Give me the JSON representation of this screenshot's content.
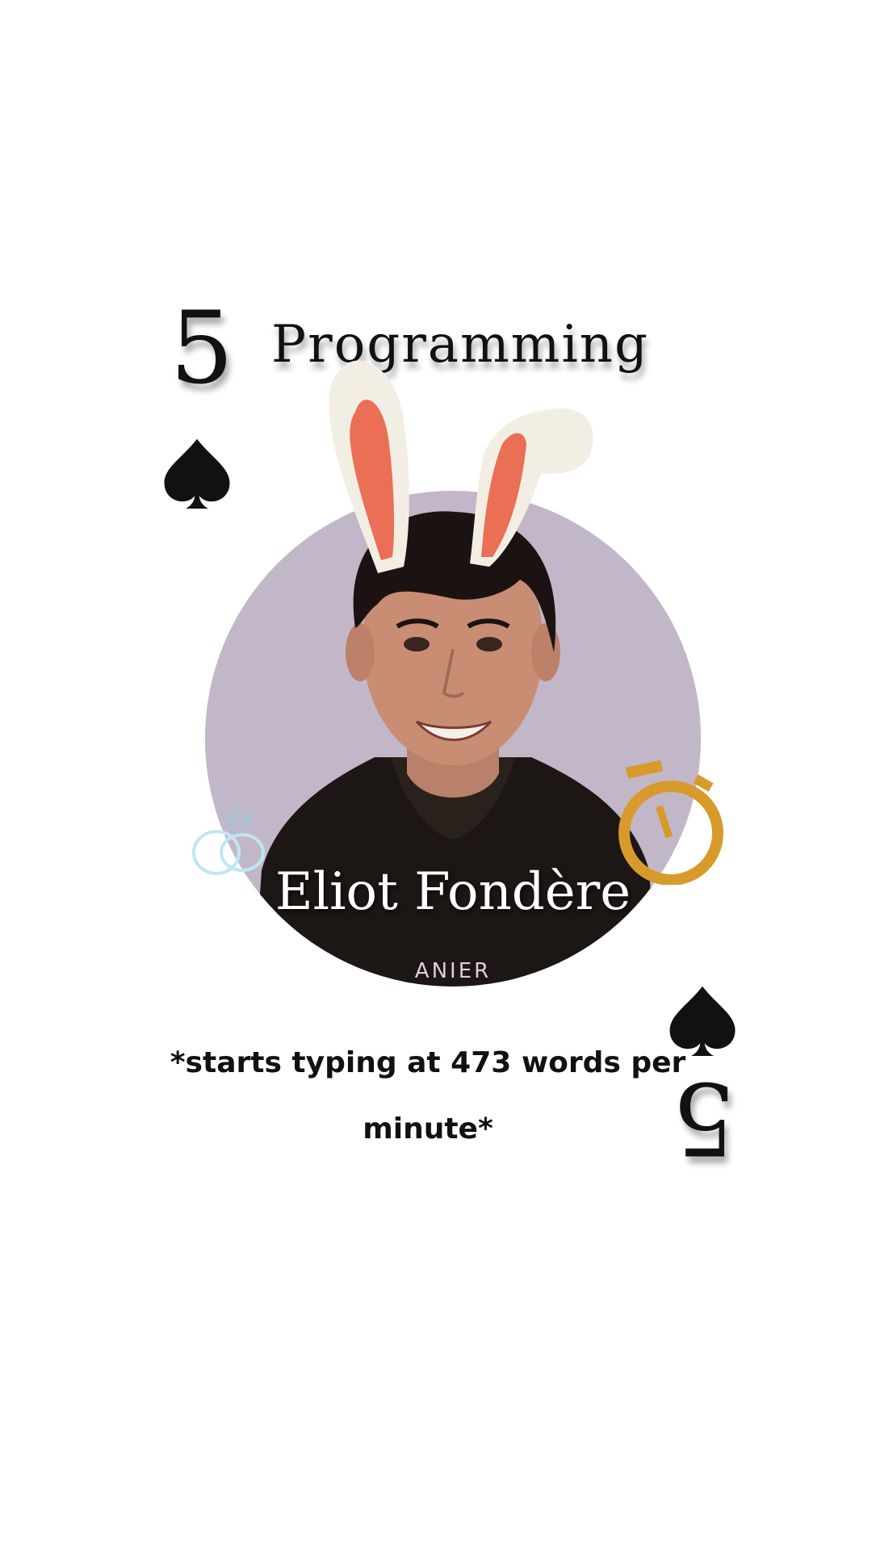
{
  "card": {
    "rank": "5",
    "suit_icon": "spade-icon",
    "title": "Programming",
    "name": "Eliot Fondère",
    "shirt_text": "ANIER",
    "caption": "*starts typing at 473 words per minute*",
    "colors": {
      "background": "#ffffff",
      "portrait_bg": "#c2b7c8",
      "ear_outer": "#f3eee4",
      "ear_inner": "#ea6f55",
      "stopwatch": "#d89a2a",
      "rings": "#bfe6f2",
      "ink": "#111111"
    },
    "icons": [
      "spade-icon",
      "bunny-ears-icon",
      "rings-icon",
      "stopwatch-icon"
    ]
  }
}
